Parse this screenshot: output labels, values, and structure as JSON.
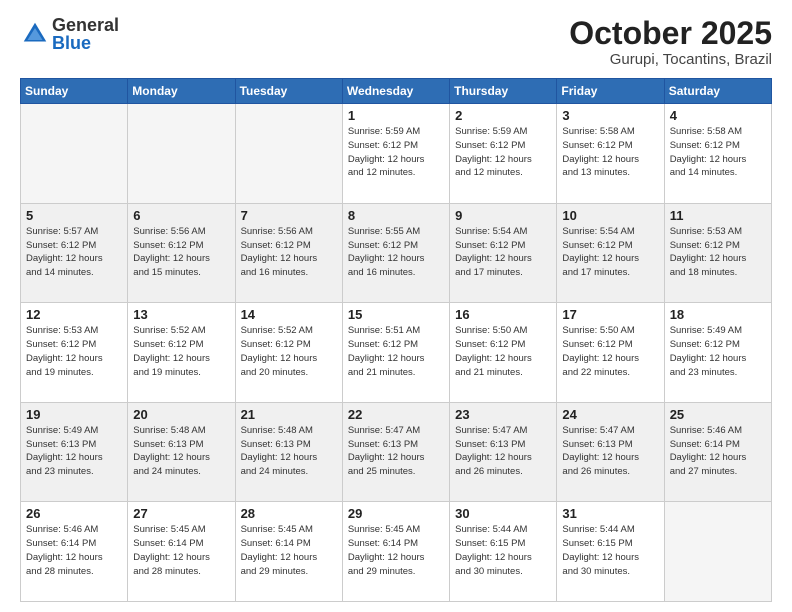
{
  "logo": {
    "general": "General",
    "blue": "Blue"
  },
  "title": "October 2025",
  "location": "Gurupi, Tocantins, Brazil",
  "weekdays": [
    "Sunday",
    "Monday",
    "Tuesday",
    "Wednesday",
    "Thursday",
    "Friday",
    "Saturday"
  ],
  "weeks": [
    [
      {
        "day": "",
        "info": ""
      },
      {
        "day": "",
        "info": ""
      },
      {
        "day": "",
        "info": ""
      },
      {
        "day": "1",
        "info": "Sunrise: 5:59 AM\nSunset: 6:12 PM\nDaylight: 12 hours\nand 12 minutes."
      },
      {
        "day": "2",
        "info": "Sunrise: 5:59 AM\nSunset: 6:12 PM\nDaylight: 12 hours\nand 12 minutes."
      },
      {
        "day": "3",
        "info": "Sunrise: 5:58 AM\nSunset: 6:12 PM\nDaylight: 12 hours\nand 13 minutes."
      },
      {
        "day": "4",
        "info": "Sunrise: 5:58 AM\nSunset: 6:12 PM\nDaylight: 12 hours\nand 14 minutes."
      }
    ],
    [
      {
        "day": "5",
        "info": "Sunrise: 5:57 AM\nSunset: 6:12 PM\nDaylight: 12 hours\nand 14 minutes."
      },
      {
        "day": "6",
        "info": "Sunrise: 5:56 AM\nSunset: 6:12 PM\nDaylight: 12 hours\nand 15 minutes."
      },
      {
        "day": "7",
        "info": "Sunrise: 5:56 AM\nSunset: 6:12 PM\nDaylight: 12 hours\nand 16 minutes."
      },
      {
        "day": "8",
        "info": "Sunrise: 5:55 AM\nSunset: 6:12 PM\nDaylight: 12 hours\nand 16 minutes."
      },
      {
        "day": "9",
        "info": "Sunrise: 5:54 AM\nSunset: 6:12 PM\nDaylight: 12 hours\nand 17 minutes."
      },
      {
        "day": "10",
        "info": "Sunrise: 5:54 AM\nSunset: 6:12 PM\nDaylight: 12 hours\nand 17 minutes."
      },
      {
        "day": "11",
        "info": "Sunrise: 5:53 AM\nSunset: 6:12 PM\nDaylight: 12 hours\nand 18 minutes."
      }
    ],
    [
      {
        "day": "12",
        "info": "Sunrise: 5:53 AM\nSunset: 6:12 PM\nDaylight: 12 hours\nand 19 minutes."
      },
      {
        "day": "13",
        "info": "Sunrise: 5:52 AM\nSunset: 6:12 PM\nDaylight: 12 hours\nand 19 minutes."
      },
      {
        "day": "14",
        "info": "Sunrise: 5:52 AM\nSunset: 6:12 PM\nDaylight: 12 hours\nand 20 minutes."
      },
      {
        "day": "15",
        "info": "Sunrise: 5:51 AM\nSunset: 6:12 PM\nDaylight: 12 hours\nand 21 minutes."
      },
      {
        "day": "16",
        "info": "Sunrise: 5:50 AM\nSunset: 6:12 PM\nDaylight: 12 hours\nand 21 minutes."
      },
      {
        "day": "17",
        "info": "Sunrise: 5:50 AM\nSunset: 6:12 PM\nDaylight: 12 hours\nand 22 minutes."
      },
      {
        "day": "18",
        "info": "Sunrise: 5:49 AM\nSunset: 6:12 PM\nDaylight: 12 hours\nand 23 minutes."
      }
    ],
    [
      {
        "day": "19",
        "info": "Sunrise: 5:49 AM\nSunset: 6:13 PM\nDaylight: 12 hours\nand 23 minutes."
      },
      {
        "day": "20",
        "info": "Sunrise: 5:48 AM\nSunset: 6:13 PM\nDaylight: 12 hours\nand 24 minutes."
      },
      {
        "day": "21",
        "info": "Sunrise: 5:48 AM\nSunset: 6:13 PM\nDaylight: 12 hours\nand 24 minutes."
      },
      {
        "day": "22",
        "info": "Sunrise: 5:47 AM\nSunset: 6:13 PM\nDaylight: 12 hours\nand 25 minutes."
      },
      {
        "day": "23",
        "info": "Sunrise: 5:47 AM\nSunset: 6:13 PM\nDaylight: 12 hours\nand 26 minutes."
      },
      {
        "day": "24",
        "info": "Sunrise: 5:47 AM\nSunset: 6:13 PM\nDaylight: 12 hours\nand 26 minutes."
      },
      {
        "day": "25",
        "info": "Sunrise: 5:46 AM\nSunset: 6:14 PM\nDaylight: 12 hours\nand 27 minutes."
      }
    ],
    [
      {
        "day": "26",
        "info": "Sunrise: 5:46 AM\nSunset: 6:14 PM\nDaylight: 12 hours\nand 28 minutes."
      },
      {
        "day": "27",
        "info": "Sunrise: 5:45 AM\nSunset: 6:14 PM\nDaylight: 12 hours\nand 28 minutes."
      },
      {
        "day": "28",
        "info": "Sunrise: 5:45 AM\nSunset: 6:14 PM\nDaylight: 12 hours\nand 29 minutes."
      },
      {
        "day": "29",
        "info": "Sunrise: 5:45 AM\nSunset: 6:14 PM\nDaylight: 12 hours\nand 29 minutes."
      },
      {
        "day": "30",
        "info": "Sunrise: 5:44 AM\nSunset: 6:15 PM\nDaylight: 12 hours\nand 30 minutes."
      },
      {
        "day": "31",
        "info": "Sunrise: 5:44 AM\nSunset: 6:15 PM\nDaylight: 12 hours\nand 30 minutes."
      },
      {
        "day": "",
        "info": ""
      }
    ]
  ]
}
